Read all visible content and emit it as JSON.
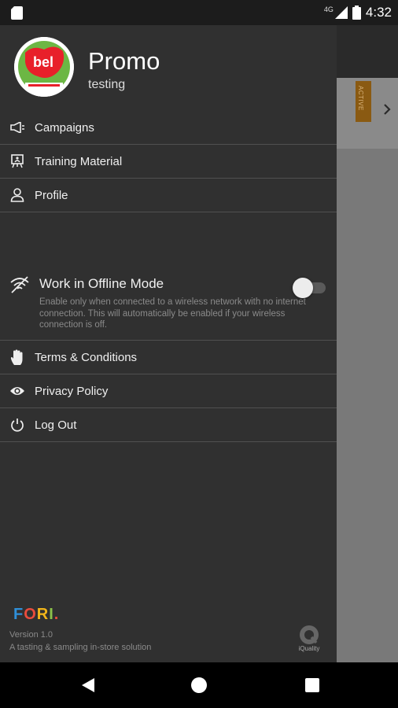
{
  "status_bar": {
    "network": "4G",
    "time": "4:32"
  },
  "drawer": {
    "app_title": "Promo",
    "app_subtitle": "testing",
    "menu": [
      {
        "label": "Campaigns",
        "icon": "megaphone-icon"
      },
      {
        "label": "Training Material",
        "icon": "presentation-icon"
      },
      {
        "label": "Profile",
        "icon": "person-icon"
      }
    ],
    "offline_mode": {
      "title": "Work in Offline Mode",
      "description": "Enable only when connected to a wireless network with no internet connection. This will automatically be enabled if your wireless connection is off.",
      "enabled": false
    },
    "menu2": [
      {
        "label": "Terms & Conditions",
        "icon": "hand-icon"
      },
      {
        "label": "Privacy Policy",
        "icon": "eye-icon"
      },
      {
        "label": "Log Out",
        "icon": "power-icon"
      }
    ],
    "footer": {
      "logo_text": "FORI.",
      "version": "Version 1.0",
      "tagline": "A tasting & sampling in-store solution",
      "partner_logo_label": "iQuality"
    }
  },
  "background": {
    "ribbon_text": "ACTIVE"
  },
  "colors": {
    "drawer_bg": "#303030",
    "divider": "#505050",
    "status_bar": "#1c1c1c",
    "ribbon": "#8a5a12"
  }
}
